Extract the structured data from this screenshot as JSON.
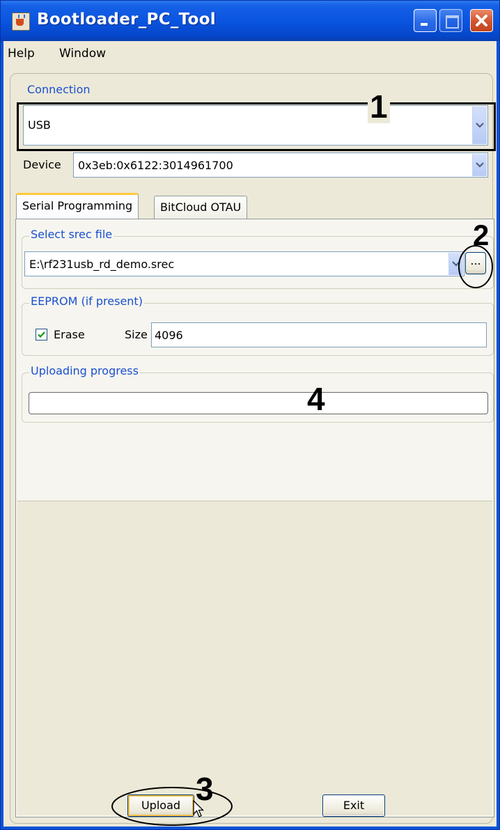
{
  "window": {
    "title": "Bootloader_PC_Tool"
  },
  "menu": {
    "items": [
      "Help",
      "Window"
    ]
  },
  "connection": {
    "legend": "Connection",
    "type_value": "USB",
    "device_label": "Device",
    "device_value": "0x3eb:0x6122:3014961700"
  },
  "tabs": [
    {
      "label": "Serial Programming",
      "active": true
    },
    {
      "label": "BitCloud OTAU",
      "active": false
    }
  ],
  "srec": {
    "legend": "Select srec file",
    "file_value": "E:\\rf231usb_rd_demo.srec",
    "browse_label": "..."
  },
  "eeprom": {
    "legend": "EEPROM (if present)",
    "erase_label": "Erase",
    "erase_checked": true,
    "size_label": "Size",
    "size_value": "4096"
  },
  "progress": {
    "legend": "Uploading progress",
    "value": 0
  },
  "buttons": {
    "upload": "Upload",
    "exit": "Exit"
  },
  "callouts": [
    "1",
    "2",
    "3",
    "4"
  ],
  "colors": {
    "titlebar": "#0a55e0",
    "legend_text": "#1a4fd0",
    "frame": "#0a53d8",
    "panel": "#ece9d8"
  },
  "icons": {
    "app": "java-cup-icon",
    "minimize": "minimize-icon",
    "maximize": "maximize-icon",
    "close": "close-icon",
    "dropdown": "chevron-down-icon",
    "cursor": "mouse-pointer-icon"
  }
}
